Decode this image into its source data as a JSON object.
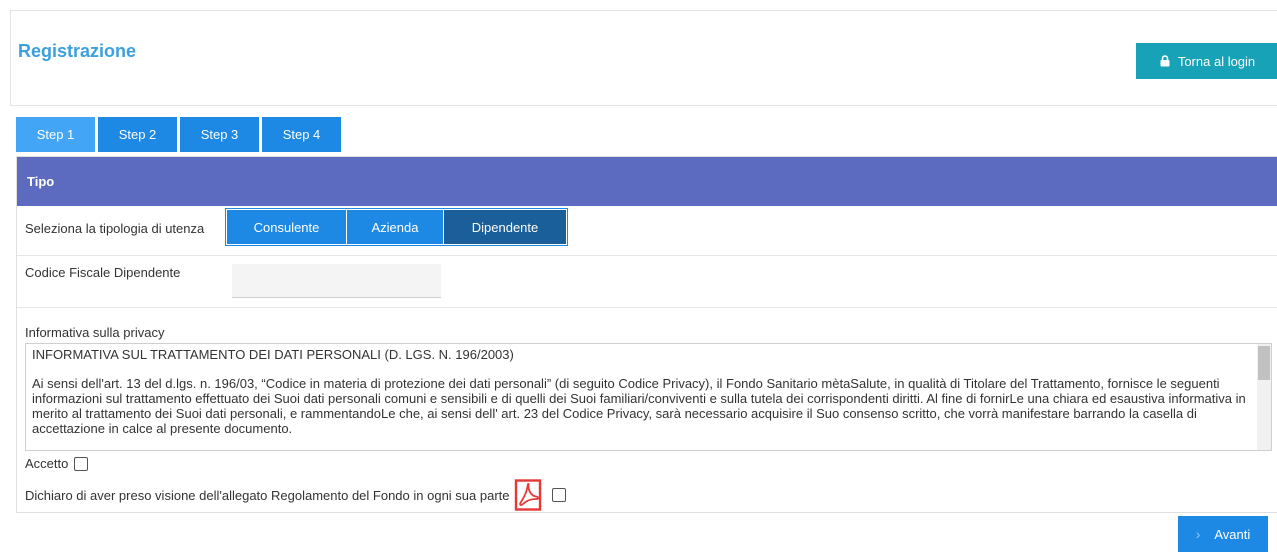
{
  "header": {
    "title": "Registrazione",
    "back_button": "Torna al login"
  },
  "tabs": [
    {
      "label": "Step 1",
      "active": true
    },
    {
      "label": "Step 2",
      "active": false
    },
    {
      "label": "Step 3",
      "active": false
    },
    {
      "label": "Step 4",
      "active": false
    }
  ],
  "section": {
    "title": "Tipo",
    "user_type_label": "Seleziona la tipologia di utenza",
    "user_types": [
      {
        "label": "Consulente",
        "selected": false
      },
      {
        "label": "Azienda",
        "selected": false
      },
      {
        "label": "Dipendente",
        "selected": true
      }
    ],
    "codice_fiscale_label": "Codice Fiscale Dipendente",
    "codice_fiscale_value": "",
    "privacy_label": "Informativa sulla privacy",
    "privacy_heading": "INFORMATIVA SUL TRATTAMENTO DEI DATI PERSONALI (D. LGS. N. 196/2003)",
    "privacy_text": "Ai sensi dell'art. 13 del d.lgs. n. 196/03, “Codice in materia di protezione dei dati personali” (di seguito Codice Privacy), il Fondo Sanitario mètaSalute, in qualità di Titolare del Trattamento, fornisce le seguenti informazioni sul trattamento effettuato dei Suoi dati personali comuni e sensibili e di quelli dei Suoi familiari/conviventi e sulla tutela dei corrispondenti diritti. Al fine di fornirLe una chiara ed esaustiva informativa in merito al trattamento dei Suoi dati personali, e rammentandoLe che, ai sensi dell' art. 23 del Codice Privacy, sarà necessario acquisire il Suo consenso scritto, che vorrà manifestare barrando la casella di accettazione in calce al presente documento.",
    "accept_label": "Accetto",
    "accept_checked": false,
    "declare_label": "Dichiaro di aver preso visione dell'allegato Regolamento del Fondo in ogni sua parte",
    "declare_checked": false
  },
  "footer": {
    "next_button": "Avanti"
  },
  "colors": {
    "title": "#3aa0de",
    "teal_button": "#17a2b8",
    "tab_blue": "#1e88e5",
    "header_band": "#5c6bc0",
    "selected_type": "#1a5e9a",
    "pdf_red": "#e53935"
  },
  "icons": {
    "back_button": "lock-icon",
    "declare_attachment": "pdf-icon",
    "next_button": "chevron-right-icon"
  }
}
